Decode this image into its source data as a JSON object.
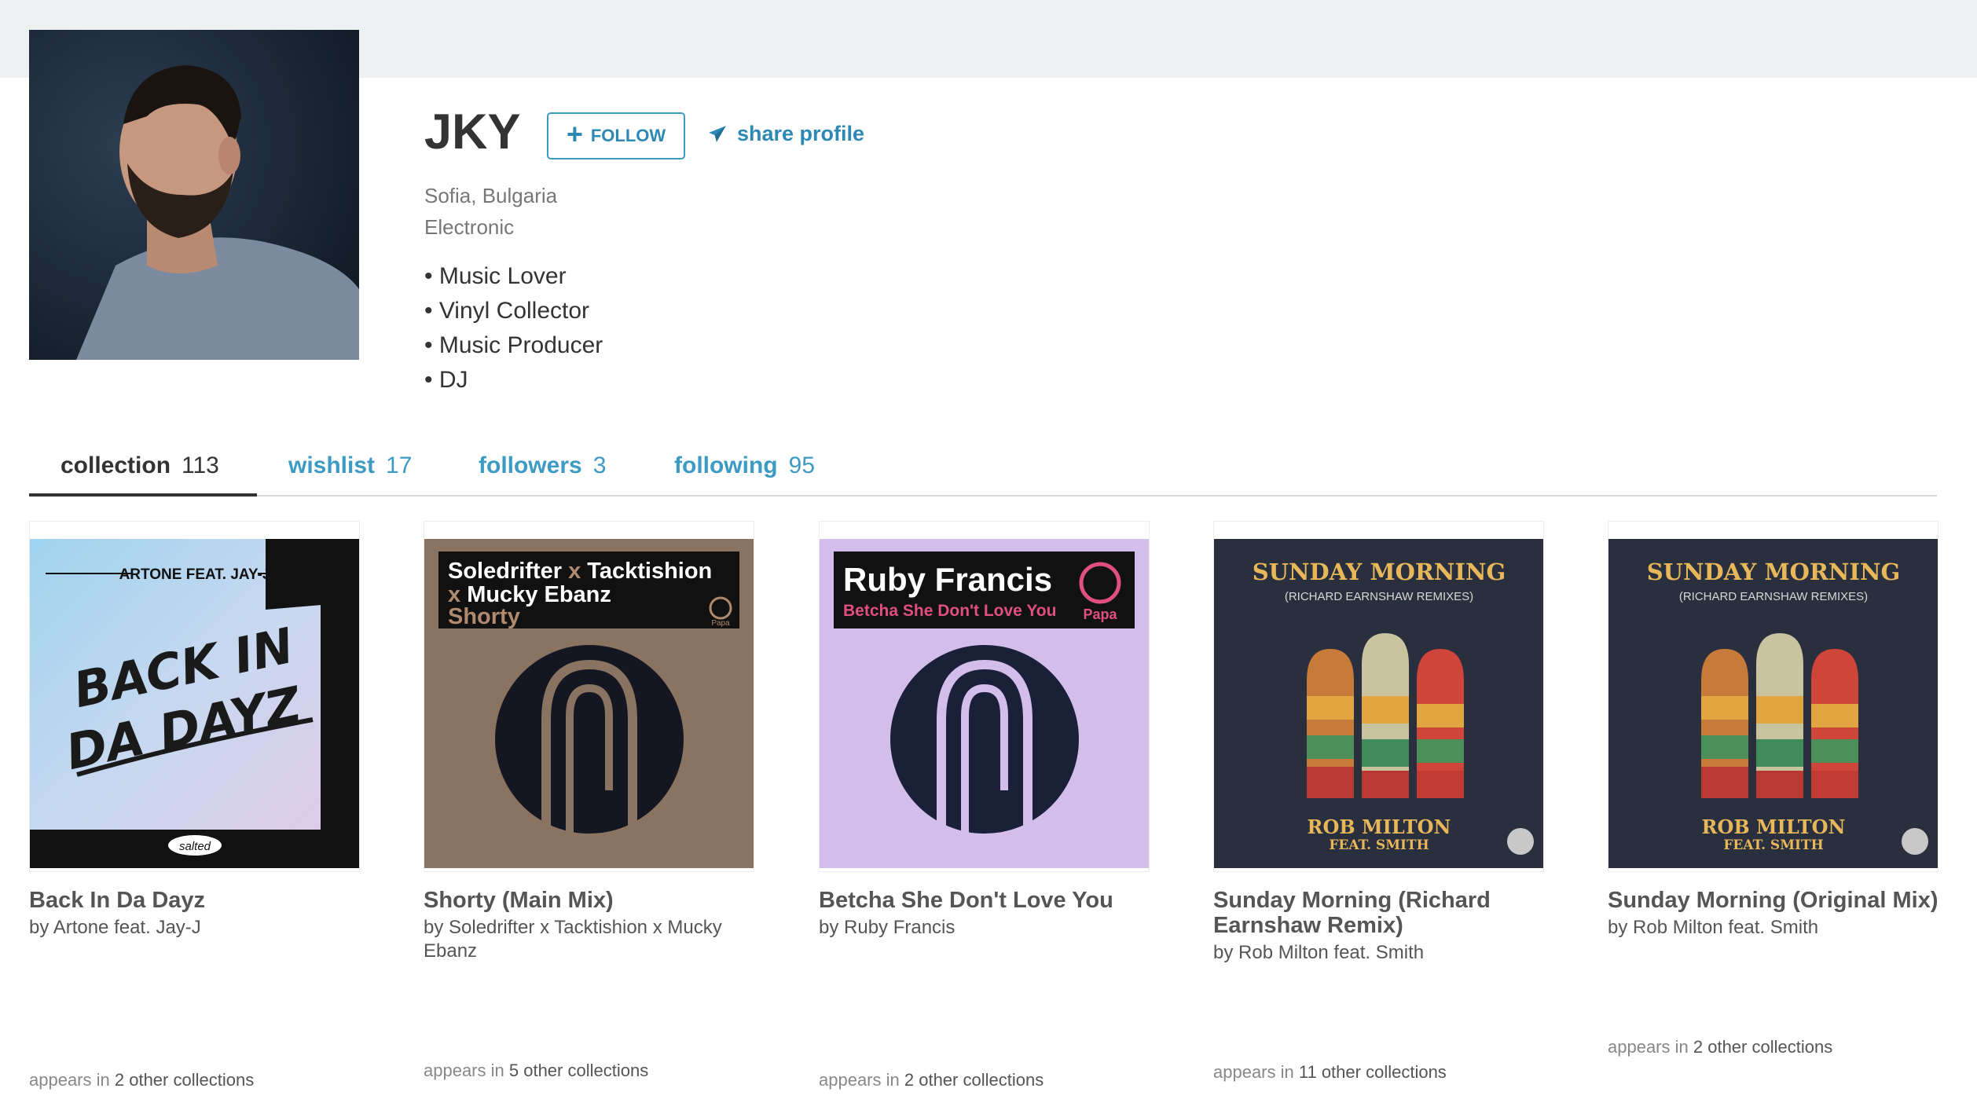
{
  "profile": {
    "name": "JKY",
    "follow_label": "FOLLOW",
    "share_label": "share profile",
    "location": "Sofia, Bulgaria",
    "genre": "Electronic",
    "bio": [
      "Music Lover",
      "Vinyl Collector",
      "Music Producer",
      "DJ"
    ]
  },
  "tabs": [
    {
      "label": "collection",
      "count": "113",
      "active": true
    },
    {
      "label": "wishlist",
      "count": "17",
      "active": false
    },
    {
      "label": "followers",
      "count": "3",
      "active": false
    },
    {
      "label": "following",
      "count": "95",
      "active": false
    }
  ],
  "collection": [
    {
      "title": "Back In Da Dayz",
      "artist": "by Artone feat. Jay-J",
      "appears_prefix": "appears in",
      "appears_count": "2 other collections",
      "cover_text": {
        "top": "ARTONE FEAT. JAY-J",
        "line1": "BACK IN",
        "line2": "DA DAYZ",
        "label": "salted"
      }
    },
    {
      "title": "Shorty (Main Mix)",
      "artist": "by Soledrifter x Tacktishion x Mucky Ebanz",
      "appears_prefix": "appears in",
      "appears_count": "5 other collections",
      "cover_text": {
        "line1a": "Soledrifter",
        "x1": " x ",
        "line1b": "Tacktishion",
        "x2": "x ",
        "line2": "Mucky Ebanz",
        "line3": "Shorty",
        "label": "Papa"
      }
    },
    {
      "title": "Betcha She Don't Love You",
      "artist": "by Ruby Francis",
      "appears_prefix": "appears in",
      "appears_count": "2 other collections",
      "cover_text": {
        "line1": "Ruby Francis",
        "line2": "Betcha She Don't Love You",
        "label": "Papa"
      }
    },
    {
      "title": "Sunday Morning (Richard Earnshaw Remix)",
      "artist": "by Rob Milton feat. Smith",
      "appears_prefix": "appears in",
      "appears_count": "11 other collections",
      "cover_text": {
        "line1": "SUNDAY MORNING",
        "line2": "(RICHARD EARNSHAW REMIXES)",
        "line3": "ROB MILTON",
        "line4": "FEAT. SMITH"
      }
    },
    {
      "title": "Sunday Morning (Original Mix)",
      "artist": "by Rob Milton feat. Smith",
      "appears_prefix": "appears in",
      "appears_count": "2 other collections",
      "cover_text": {
        "line1": "SUNDAY MORNING",
        "line2": "(RICHARD EARNSHAW REMIXES)",
        "line3": "ROB MILTON",
        "line4": "FEAT. SMITH"
      }
    }
  ],
  "colors": {
    "accent": "#3d9bc3",
    "text": "#333333",
    "muted": "#777777"
  }
}
